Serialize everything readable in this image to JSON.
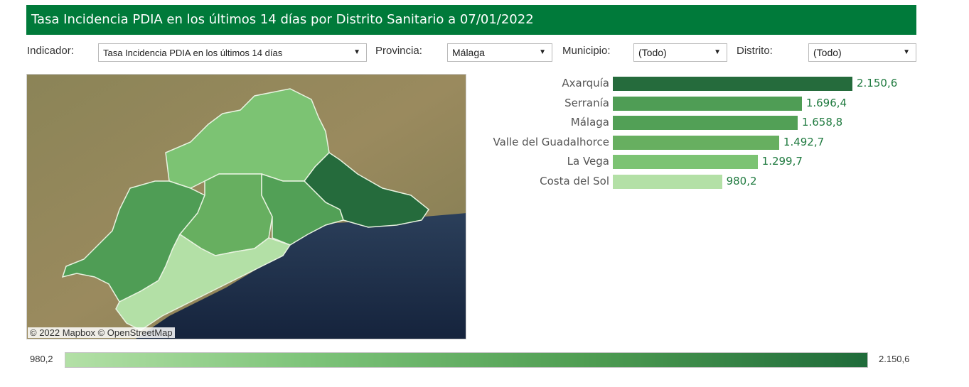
{
  "title": "Tasa Incidencia PDIA en los últimos 14 días por Distrito Sanitario a 07/01/2022",
  "filters": {
    "indicador": {
      "label": "Indicador:",
      "value": "Tasa Incidencia PDIA en los últimos 14 días"
    },
    "provincia": {
      "label": "Provincia:",
      "value": "Málaga"
    },
    "municipio": {
      "label": "Municipio:",
      "value": "(Todo)"
    },
    "distrito": {
      "label": "Distrito:",
      "value": "(Todo)"
    }
  },
  "map": {
    "attribution": "© 2022 Mapbox  © OpenStreetMap"
  },
  "colors": {
    "header": "#007a3a",
    "scale_low": "#b3e0a6",
    "scale_high": "#1f6b3a",
    "value_text": "#1f7a3f"
  },
  "chart_data": {
    "type": "bar",
    "orientation": "horizontal",
    "categories": [
      "Axarquía",
      "Serranía",
      "Málaga",
      "Valle del Guadalhorce",
      "La Vega",
      "Costa del Sol"
    ],
    "values": [
      2150.6,
      1696.4,
      1658.8,
      1492.7,
      1299.7,
      980.2
    ],
    "value_labels": [
      "2.150,6",
      "1.696,4",
      "1.658,8",
      "1.492,7",
      "1.299,7",
      "980,2"
    ],
    "colors": [
      "#256b3c",
      "#4f9d55",
      "#52a056",
      "#67af60",
      "#7cc373",
      "#b3e0a6"
    ],
    "title": "",
    "xlabel": "",
    "ylabel": "",
    "grid": false
  },
  "legend": {
    "min_label": "980,2",
    "max_label": "2.150,6"
  }
}
